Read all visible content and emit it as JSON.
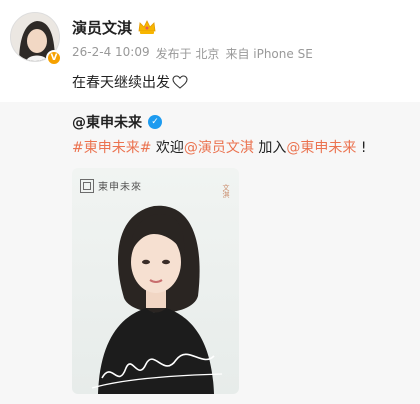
{
  "author": {
    "name": "演员文淇",
    "meta": {
      "time": "26-2-4 10:09",
      "location": "发布于 北京",
      "device": "来自 iPhone SE"
    },
    "text": "在春天继续出发"
  },
  "repost": {
    "author": "@東申未来",
    "text_parts": [
      "#東申未来#",
      " 欢迎",
      "@演员文淇",
      " 加入",
      "@東申未来",
      " !"
    ],
    "image": {
      "logo": "東申未來",
      "side_tag": "文淇"
    }
  },
  "colors": {
    "link": "#eb7350",
    "verified_orange": "#f6a100",
    "verified_blue": "#1d9bf0"
  }
}
